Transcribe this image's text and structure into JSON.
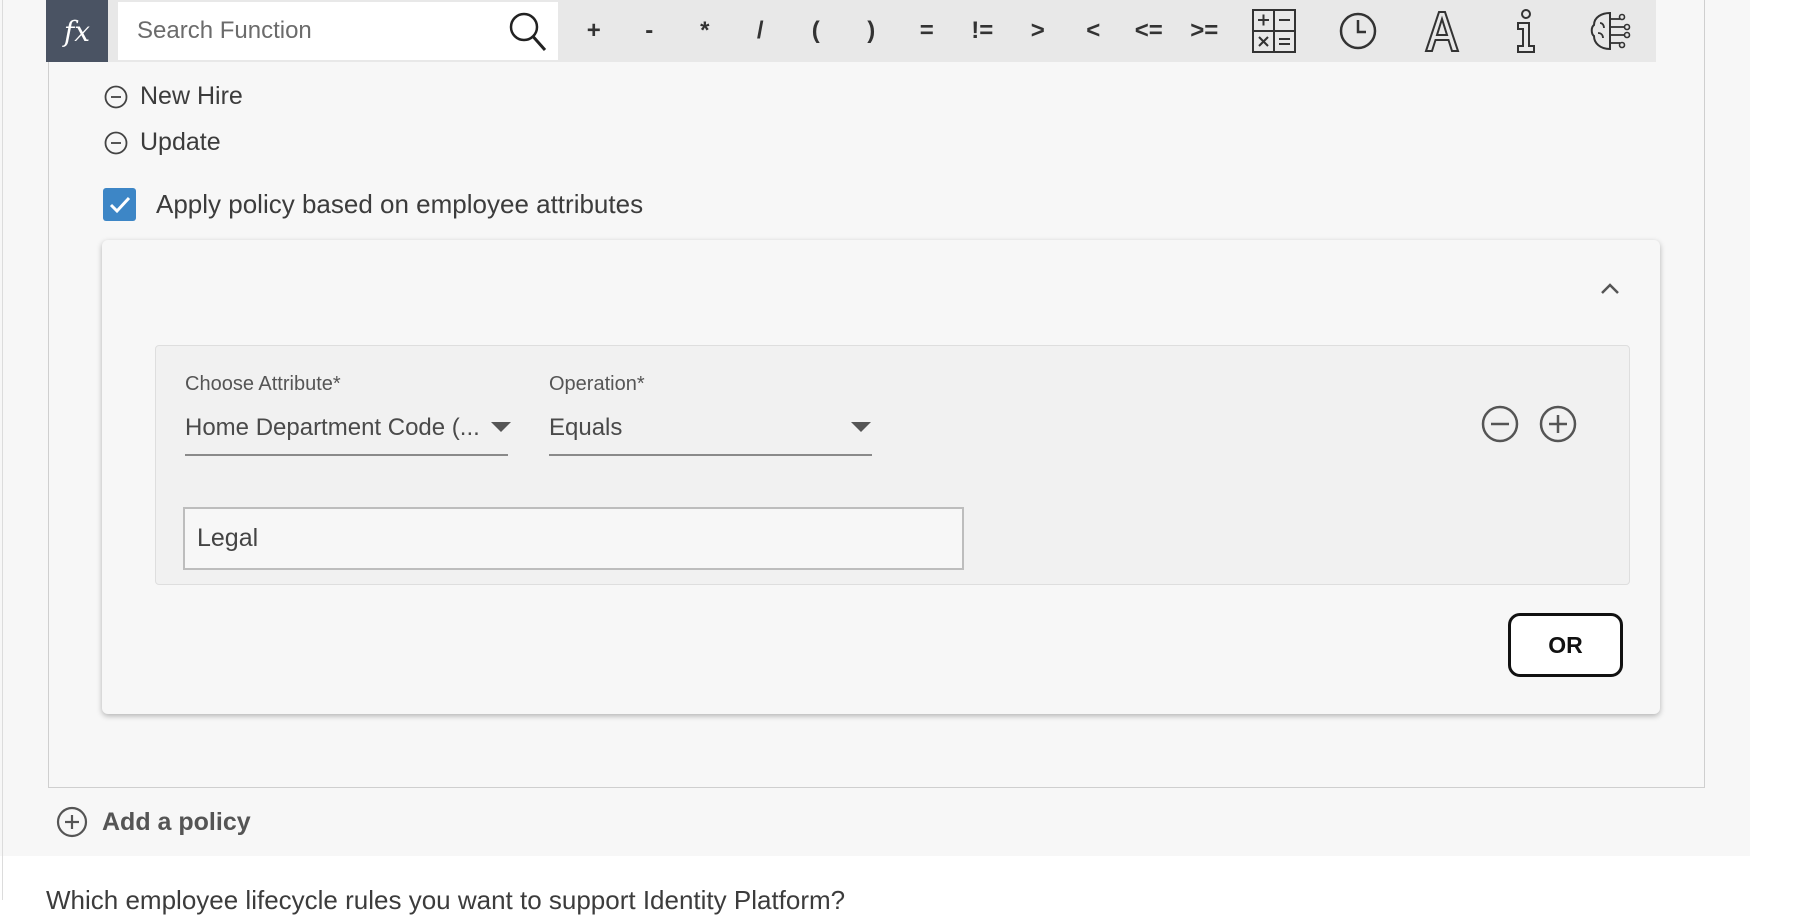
{
  "toolbar": {
    "fx_label": "fx",
    "search_placeholder": "Search Function",
    "operators": [
      "+",
      "-",
      "*",
      "/",
      "(",
      ")",
      "=",
      "!=",
      ">",
      "<",
      "<=",
      ">="
    ],
    "icons": [
      "calculator-icon",
      "clock-icon",
      "text-format-icon",
      "info-icon",
      "ai-brain-icon"
    ]
  },
  "events": [
    {
      "label": "New Hire",
      "icon": "minus-circle-icon"
    },
    {
      "label": "Update",
      "icon": "minus-circle-icon"
    }
  ],
  "apply_attributes": {
    "checked": true,
    "label": "Apply policy based on employee attributes"
  },
  "rule": {
    "attribute_label": "Choose Attribute*",
    "attribute_value": "Home Department Code (...",
    "operation_label": "Operation*",
    "operation_value": "Equals",
    "value": "Legal"
  },
  "or_button": "OR",
  "add_policy": "Add a policy",
  "question_text": "Which employee lifecycle rules you want to support Identity Platform?",
  "colors": {
    "accent": "#3d86c6",
    "fx_bg": "#4a5363",
    "toolbar_bg": "#e8e8e8"
  }
}
